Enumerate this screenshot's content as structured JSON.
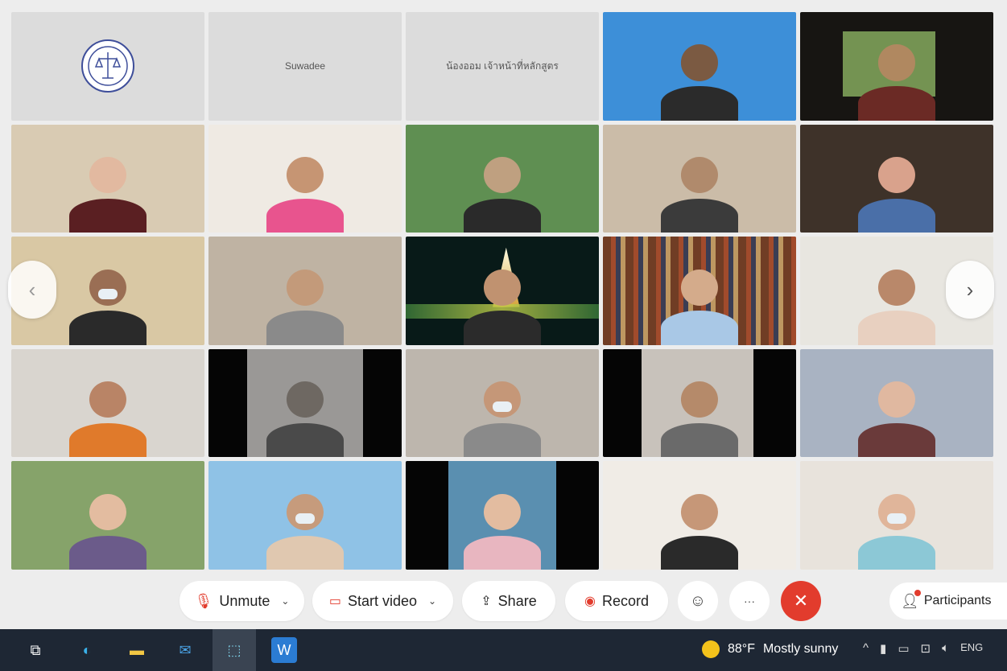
{
  "meeting": {
    "tiles": [
      {
        "kind": "logo"
      },
      {
        "kind": "name",
        "name": "Suwadee"
      },
      {
        "kind": "name",
        "name": "น้องออม เจ้าหน้าที่หลักสูตร"
      },
      {
        "kind": "video",
        "bg": "#3d8fd8",
        "skin": "#7b5a42",
        "shirt": "#2b2b2b"
      },
      {
        "kind": "video",
        "bg": "#171512",
        "skin": "#b08860",
        "shirt": "#6b2a25",
        "window": true
      },
      {
        "kind": "video",
        "bg": "#d9cbb3",
        "skin": "#e2b9a0",
        "shirt": "#5a1f22"
      },
      {
        "kind": "video",
        "bg": "#efeae3",
        "skin": "#c69573",
        "shirt": "#e8548e"
      },
      {
        "kind": "video",
        "bg": "#5f8f52",
        "skin": "#bfa080",
        "shirt": "#2a2a2a"
      },
      {
        "kind": "video",
        "bg": "#cbbca8",
        "skin": "#b08a6c",
        "shirt": "#3b3b3b"
      },
      {
        "kind": "video",
        "bg": "#3e3229",
        "skin": "#d9a28c",
        "shirt": "#4a6fa8"
      },
      {
        "kind": "video",
        "bg": "#d9c8a4",
        "skin": "#9a6e54",
        "shirt": "#2a2a2a",
        "mask": true
      },
      {
        "kind": "video",
        "bg": "#bfb3a3",
        "skin": "#c39a7a",
        "shirt": "#8a8a8a"
      },
      {
        "kind": "video",
        "bg": "#081a18",
        "skin": "#c09270",
        "shirt": "#2b2b2b",
        "temple": true
      },
      {
        "kind": "video",
        "bg": "#7b4a2e",
        "skin": "#d4ab8b",
        "shirt": "#a9c8e6",
        "books": true
      },
      {
        "kind": "video",
        "bg": "#e8e6e0",
        "skin": "#b9886a",
        "shirt": "#e8d0c0"
      },
      {
        "kind": "video",
        "bg": "#d9d5cf",
        "skin": "#b98466",
        "shirt": "#e07a2b"
      },
      {
        "kind": "video",
        "bg": "#9a9896",
        "skin": "#6e6862",
        "shirt": "#4a4a4a",
        "bars": [
          0,
          20,
          80,
          100
        ]
      },
      {
        "kind": "video",
        "bg": "#bdb6ad",
        "skin": "#c59778",
        "shirt": "#8a8a8a",
        "mask": true
      },
      {
        "kind": "video",
        "bg": "#c8c2bb",
        "skin": "#b58a6a",
        "shirt": "#6a6a6a",
        "bars": [
          0,
          20,
          78,
          100
        ]
      },
      {
        "kind": "video",
        "bg": "#a9b3c2",
        "skin": "#e0b8a0",
        "shirt": "#6a3a3a"
      },
      {
        "kind": "video",
        "bg": "#86a36a",
        "skin": "#e3bca0",
        "shirt": "#6b5b8a"
      },
      {
        "kind": "video",
        "bg": "#8fc2e6",
        "skin": "#c69b7c",
        "shirt": "#e0c8b0",
        "mask": true
      },
      {
        "kind": "video",
        "bg": "#5a8fb0",
        "skin": "#e3bca0",
        "shirt": "#e8b6c0",
        "bars": [
          0,
          22,
          78,
          100
        ]
      },
      {
        "kind": "video",
        "bg": "#f0ece6",
        "skin": "#c69778",
        "shirt": "#2a2a2a"
      },
      {
        "kind": "video",
        "bg": "#e8e3dc",
        "skin": "#e0b59a",
        "shirt": "#8cc8d6",
        "mask": true
      }
    ]
  },
  "controls": {
    "unmute": "Unmute",
    "start_video": "Start video",
    "share": "Share",
    "record": "Record",
    "more": "···",
    "participants": "Participants"
  },
  "taskbar": {
    "weather_temp": "88°F",
    "weather_text": "Mostly sunny",
    "lang": "ENG"
  }
}
